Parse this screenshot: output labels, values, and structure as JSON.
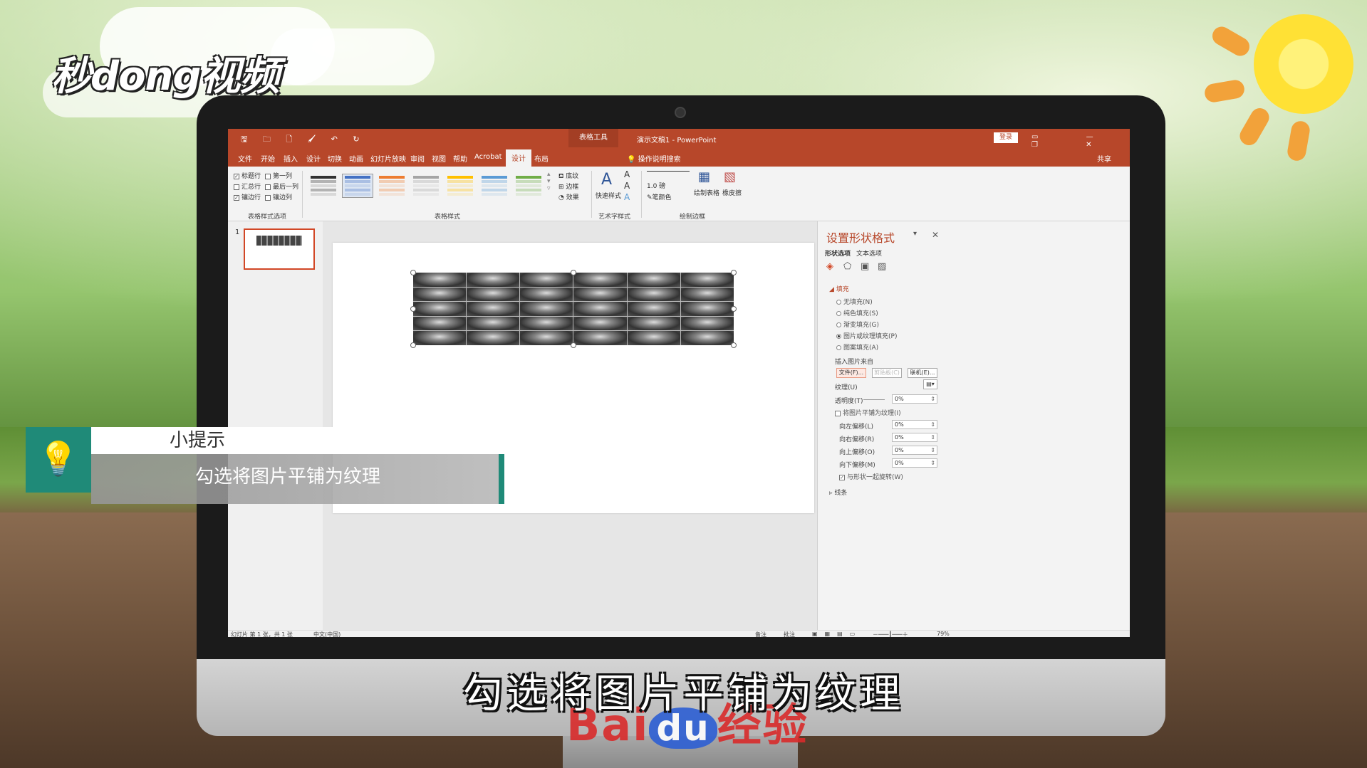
{
  "logo": {
    "text": "秒dong视频"
  },
  "titlebar": {
    "quick_access": "🖫 🗀 🗋 🖌 ↶ ↻",
    "context_tab": "表格工具",
    "doc_title": "演示文稿1 - PowerPoint",
    "login": "登录",
    "window_controls": "▭ — ❐ ✕"
  },
  "tabs": [
    "文件",
    "开始",
    "插入",
    "设计",
    "切换",
    "动画",
    "幻灯片放映",
    "审阅",
    "视图",
    "帮助",
    "Acrobat",
    "设计",
    "布局"
  ],
  "tell_me": "操作说明搜索",
  "share": "共享",
  "ribbon": {
    "options": [
      {
        "label": "标题行",
        "checked": true
      },
      {
        "label": "第一列",
        "checked": false
      },
      {
        "label": "汇总行",
        "checked": false
      },
      {
        "label": "最后一列",
        "checked": false
      },
      {
        "label": "镶边行",
        "checked": true
      },
      {
        "label": "镶边列",
        "checked": false
      }
    ],
    "group_options": "表格样式选项",
    "group_styles": "表格样式",
    "shading": "底纹",
    "border": "边框",
    "effect": "效果",
    "quick_styles": "快速样式",
    "group_wordart": "艺术字样式",
    "pen_weight": "1.0 磅",
    "pen_color": "笔颜色",
    "draw_table": "绘制表格",
    "eraser": "橡皮擦",
    "group_borders": "绘制边框",
    "style_colors": [
      "#333333",
      "#4472c4",
      "#ed7d31",
      "#a5a5a5",
      "#ffc000",
      "#5b9bd5",
      "#70ad47"
    ]
  },
  "thumb": {
    "number": "1"
  },
  "pane": {
    "title": "设置形状格式",
    "tab_shape": "形状选项",
    "tab_text": "文本选项",
    "fill_section": "填充",
    "radios": [
      {
        "label": "无填充(N)",
        "on": false
      },
      {
        "label": "纯色填充(S)",
        "on": false
      },
      {
        "label": "渐变填充(G)",
        "on": false
      },
      {
        "label": "图片或纹理填充(P)",
        "on": true
      },
      {
        "label": "图案填充(A)",
        "on": false
      }
    ],
    "insert_from": "插入图片来自",
    "btn_file": "文件(F)...",
    "btn_clipboard": "剪贴板(C)",
    "btn_online": "联机(E)...",
    "texture": "纹理(U)",
    "transparency": "透明度(T)",
    "transparency_value": "0%",
    "tile": "将图片平铺为纹理(I)",
    "offsets": [
      {
        "label": "向左偏移(L)",
        "value": "0%"
      },
      {
        "label": "向右偏移(R)",
        "value": "0%"
      },
      {
        "label": "向上偏移(O)",
        "value": "0%"
      },
      {
        "label": "向下偏移(M)",
        "value": "0%"
      }
    ],
    "rotate_with_shape": "与形状一起旋转(W)",
    "line_section": "线条"
  },
  "status": {
    "slide_info": "幻灯片 第 1 张，共 1 张",
    "language": "中文(中国)",
    "notes": "备注",
    "comments": "批注",
    "zoom": "79%"
  },
  "tip": {
    "heading": "小提示",
    "body": "勾选将图片平铺为纹理"
  },
  "subtitle": "勾选将图片平铺为纹理",
  "watermark": {
    "bai": "Bai",
    "du": "du",
    "jingyan": "经验"
  }
}
